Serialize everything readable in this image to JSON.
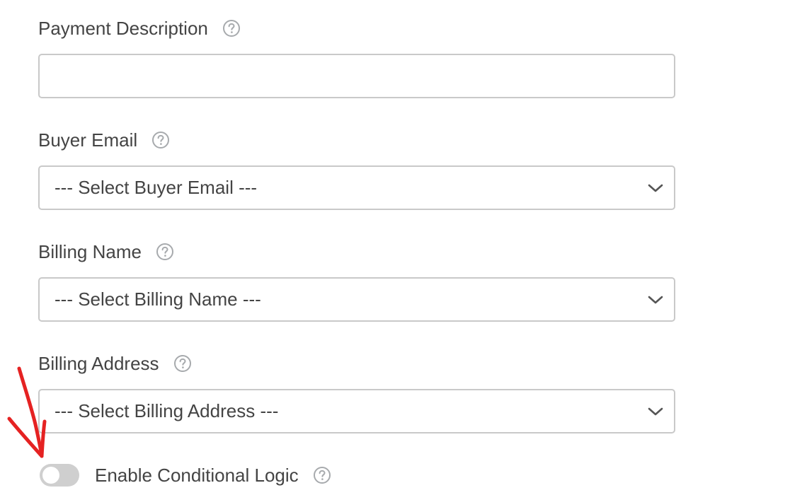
{
  "fields": [
    {
      "label": "Payment Description",
      "type": "text",
      "value": "",
      "help_icon": "question-circle-icon"
    },
    {
      "label": "Buyer Email",
      "type": "select",
      "value": "--- Select Buyer Email ---",
      "help_icon": "question-circle-icon"
    },
    {
      "label": "Billing Name",
      "type": "select",
      "value": "--- Select Billing Name ---",
      "help_icon": "question-circle-icon"
    },
    {
      "label": "Billing Address",
      "type": "select",
      "value": "--- Select Billing Address ---",
      "help_icon": "question-circle-icon"
    }
  ],
  "conditional_logic": {
    "label": "Enable Conditional Logic",
    "enabled": false
  },
  "colors": {
    "text": "#444444",
    "border": "#c9c9c9",
    "toggle_off": "#cfcfcf",
    "help_icon": "#a7aaad",
    "annotation_arrow": "#e52222"
  },
  "icons": {
    "dropdown": "chevron-down-icon",
    "annotation": "red-arrow"
  }
}
